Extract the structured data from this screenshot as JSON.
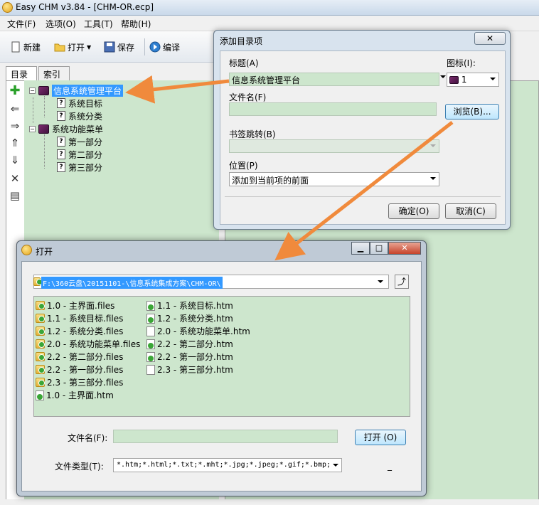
{
  "main": {
    "title": "Easy CHM v3.84 - [CHM-OR.ecp]",
    "menu": [
      "文件(F)",
      "选项(O)",
      "工具(T)",
      "帮助(H)"
    ],
    "toolbar": {
      "new": "新建",
      "open": "打开",
      "save": "保存",
      "compile": "编译"
    },
    "tabs": [
      "目录",
      "索引"
    ],
    "tree": [
      {
        "label": "信息系统管理平台",
        "kind": "book",
        "level": 0,
        "selected": true
      },
      {
        "label": "系统目标",
        "kind": "page",
        "level": 1
      },
      {
        "label": "系统分类",
        "kind": "page",
        "level": 1
      },
      {
        "label": "系统功能菜单",
        "kind": "book",
        "level": 0
      },
      {
        "label": "第一部分",
        "kind": "page",
        "level": 1
      },
      {
        "label": "第二部分",
        "kind": "page",
        "level": 1
      },
      {
        "label": "第三部分",
        "kind": "page",
        "level": 1
      }
    ]
  },
  "add_dialog": {
    "title": "添加目录项",
    "title_label": "标题(A)",
    "title_value": "信息系统管理平台",
    "icon_label": "图标(I):",
    "icon_value": "1",
    "filename_label": "文件名(F)",
    "filename_value": "",
    "browse": "浏览(B)...",
    "bookmark_label": "书签跳转(B)",
    "bookmark_value": "",
    "position_label": "位置(P)",
    "position_value": "添加到当前项的前面",
    "ok": "确定(O)",
    "cancel": "取消(C)"
  },
  "open_dialog": {
    "title": "打开",
    "path": "F:\\360云盘\\20151101-\\信息系统集成方案\\CHM-OR\\",
    "files_col1": [
      {
        "name": "1.0 - 主界面.files",
        "kind": "folder"
      },
      {
        "name": "1.1 - 系统目标.files",
        "kind": "folder"
      },
      {
        "name": "1.2 - 系统分类.files",
        "kind": "folder"
      },
      {
        "name": "2.0 - 系统功能菜单.files",
        "kind": "folder"
      },
      {
        "name": "2.2 - 第二部分.files",
        "kind": "folder"
      },
      {
        "name": "2.2 - 第一部分.files",
        "kind": "folder"
      },
      {
        "name": "2.3 - 第三部分.files",
        "kind": "folder"
      },
      {
        "name": "1.0 - 主界面.htm",
        "kind": "htm"
      }
    ],
    "files_col2": [
      {
        "name": "1.1 - 系统目标.htm",
        "kind": "htm"
      },
      {
        "name": "1.2 - 系统分类.htm",
        "kind": "htm"
      },
      {
        "name": "2.0 - 系统功能菜单.htm",
        "kind": "htm-plain"
      },
      {
        "name": "2.2 - 第二部分.htm",
        "kind": "htm"
      },
      {
        "name": "2.2 - 第一部分.htm",
        "kind": "htm"
      },
      {
        "name": "2.3 - 第三部分.htm",
        "kind": "htm-plain"
      }
    ],
    "filename_label": "文件名(F):",
    "filename_value": "",
    "open_button": "打开 (O)",
    "filetype_label": "文件类型(T):",
    "filetype_value": "*.htm;*.html;*.txt;*.mht;*.jpg;*.jpeg;*.gif;*.bmp;",
    "extra_mark": "_"
  },
  "colors": {
    "green_bg": "#cde6cd",
    "selection": "#3399ff",
    "arrow": "#f08a3c"
  },
  "icons": [
    "add-icon",
    "left-arrow-icon",
    "right-arrow-icon",
    "up-arrow-icon",
    "down-arrow-icon",
    "delete-icon",
    "properties-icon"
  ]
}
